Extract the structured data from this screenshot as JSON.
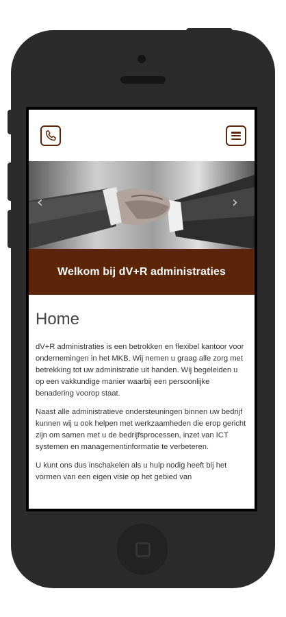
{
  "device": {
    "body_color": "#2b2b2b"
  },
  "icons": {
    "call": "phone-icon",
    "menu": "hamburger-menu-icon",
    "prev": "chevron-left-icon",
    "next": "chevron-right-icon"
  },
  "colors": {
    "brand": "#5c2409",
    "text": "#333333"
  },
  "slider": {
    "prev_label": "‹",
    "next_label": "›"
  },
  "banner": {
    "title": "Welkom bij dV+R administraties"
  },
  "page": {
    "title": "Home",
    "paragraphs": [
      "dV+R administraties is een betrokken en flexibel kantoor voor ondernemingen in het MKB. Wij nemen u graag alle zorg met betrekking tot uw administratie uit handen. Wij begeleiden u op een vakkundige manier waarbij een persoonlijke benadering voorop staat.",
      "Naast alle administratieve ondersteuningen binnen uw bedrijf kunnen wij u ook helpen met werkzaamheden die erop gericht zijn om samen met u de bedrijfsprocessen, inzet van ICT systemen en managementinformatie te verbeteren.",
      "U kunt ons dus inschakelen als u hulp nodig heeft bij het vormen van een eigen visie op het gebied van"
    ]
  }
}
